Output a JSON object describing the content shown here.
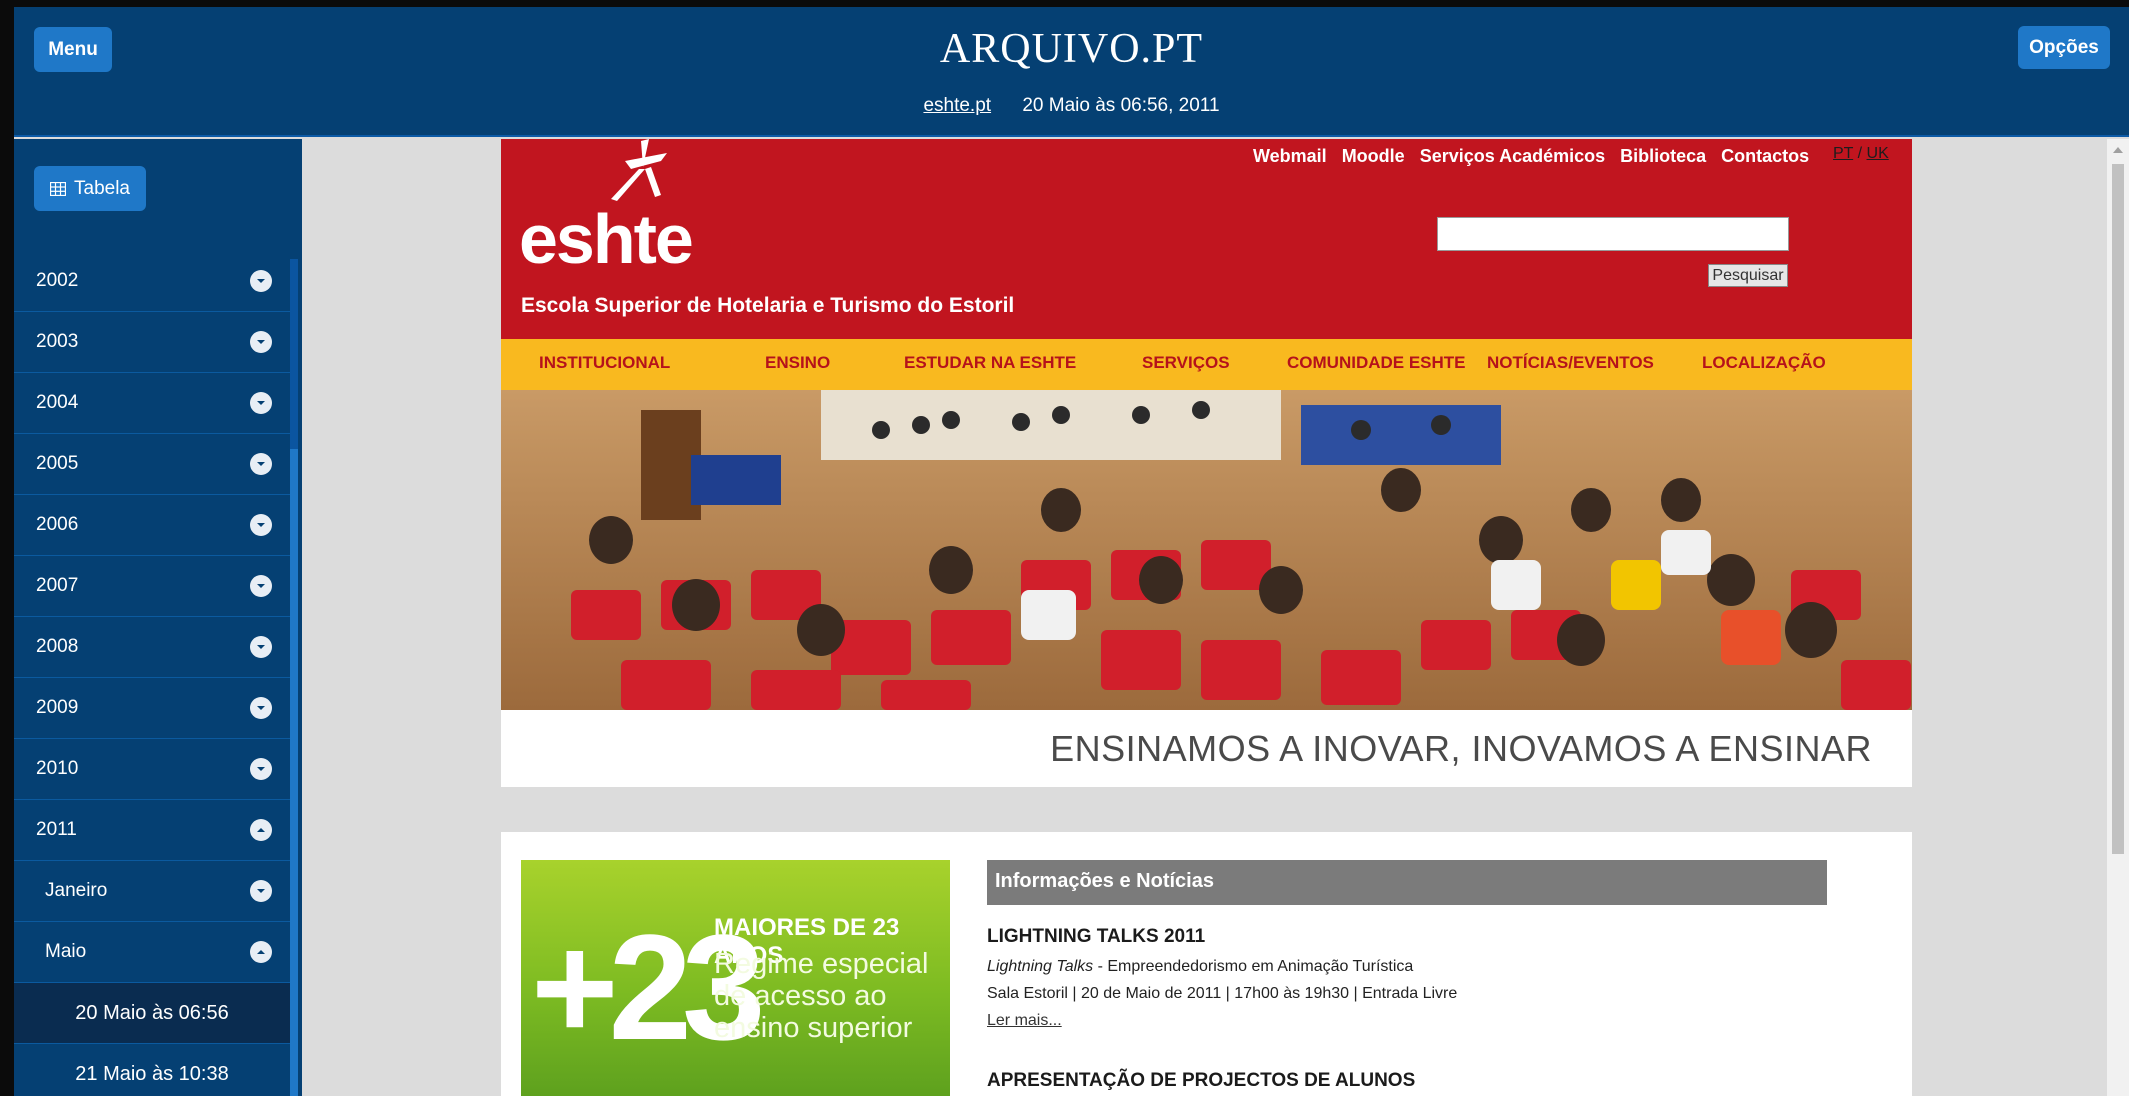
{
  "header": {
    "menu_label": "Menu",
    "logo": "ARQUIVO.PT",
    "options_label": "Opções",
    "site": "eshte.pt",
    "datetime": "20 Maio às 06:56, 2011"
  },
  "sidebar": {
    "table_label": "Tabela",
    "years": [
      "2002",
      "2003",
      "2004",
      "2005",
      "2006",
      "2007",
      "2008",
      "2009",
      "2010",
      "2011"
    ],
    "months": [
      "Janeiro",
      "Maio"
    ],
    "entries": [
      "20 Maio às 06:56",
      "21 Maio às 10:38"
    ]
  },
  "site": {
    "top_links": [
      "Webmail",
      "Moodle",
      "Serviços Académicos",
      "Biblioteca",
      "Contactos"
    ],
    "lang_pt": "PT",
    "lang_sep": "/",
    "lang_uk": "UK",
    "logo_word": "eshte",
    "school_name": "Escola Superior de Hotelaria e Turismo do Estoril",
    "search_placeholder": "",
    "search_button": "Pesquisar",
    "nav": [
      "INSTITUCIONAL",
      "ENSINO",
      "ESTUDAR NA ESHTE",
      "SERVIÇOS",
      "COMUNIDADE ESHTE",
      "NOTÍCIAS/EVENTOS",
      "LOCALIZAÇÃO"
    ],
    "slogan": "ENSINAMOS A INOVAR, INOVAMOS A ENSINAR",
    "promo": {
      "number": "+23",
      "heading": "MAIORES DE 23 ANOS",
      "line1": "Regime especial",
      "line2": "de acesso ao",
      "line3": "ensino superior"
    },
    "news": {
      "heading": "Informações e Notícias",
      "item1_title": "LIGHTNING TALKS 2011",
      "item1_sub_italic": "Lightning Talks",
      "item1_sub_rest": " - Empreendedorismo em Animação Turística",
      "item1_meta": "Sala Estoril | 20 de Maio de 2011 | 17h00 às 19h30 | Entrada Livre",
      "item1_more": "Ler mais...",
      "item2_title": "APRESENTAÇÃO DE PROJECTOS DE ALUNOS"
    }
  },
  "colors": {
    "archive_blue": "#054073",
    "button_blue": "#1f78c8",
    "eshte_red": "#c1151f",
    "nav_yellow": "#f9b91f",
    "promo_green": "#7dbb22"
  }
}
